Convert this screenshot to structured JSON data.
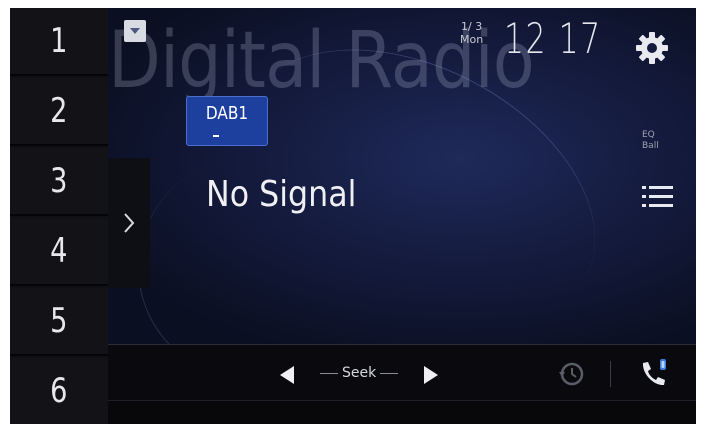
{
  "presets": [
    "1",
    "2",
    "3",
    "4",
    "5",
    "6"
  ],
  "source": {
    "watermark": "Digital Radio",
    "band": "DAB1",
    "status": "No Signal"
  },
  "date": {
    "fraction": "1/ 3",
    "weekday": "Mon"
  },
  "clock": "12 17",
  "eq_label": "EQ",
  "eq_value": "Ball",
  "controls": {
    "seek_label": "Seek"
  },
  "icons": {
    "settings": "gear-icon",
    "list": "list-icon",
    "history": "history-icon",
    "phone": "phone-icon",
    "dropdown": "chevron-down-icon",
    "side": "chevron-right-icon"
  },
  "colors": {
    "band_badge": "#1d3f9e",
    "background": "#141b3e"
  }
}
